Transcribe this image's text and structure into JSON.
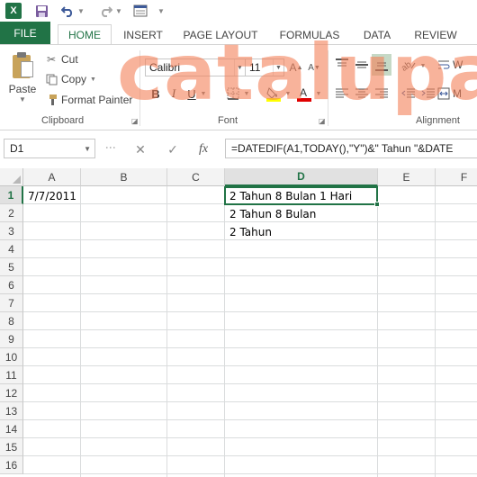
{
  "app": {
    "logo_text": "X"
  },
  "qat": {
    "save_icon": "save-icon",
    "undo_icon": "undo-icon",
    "redo_icon": "redo-icon",
    "customize_icon": "customize-icon"
  },
  "tabs": [
    {
      "label": "FILE"
    },
    {
      "label": "HOME"
    },
    {
      "label": "INSERT"
    },
    {
      "label": "PAGE LAYOUT"
    },
    {
      "label": "FORMULAS"
    },
    {
      "label": "DATA"
    },
    {
      "label": "REVIEW"
    }
  ],
  "ribbon": {
    "clipboard": {
      "paste_label": "Paste",
      "cut_label": "Cut",
      "copy_label": "Copy",
      "format_painter_label": "Format Painter",
      "group_label": "Clipboard"
    },
    "font": {
      "font_name": "Calibri",
      "font_size": "11",
      "group_label": "Font"
    },
    "alignment": {
      "group_label": "Alignment",
      "wrap_label": "W",
      "merge_label": "M"
    }
  },
  "watermark": "catalupa",
  "formula_bar": {
    "name_box": "D1",
    "fx_label": "fx",
    "formula": "=DATEDIF(A1,TODAY(),\"Y\")&\" Tahun \"&DATE"
  },
  "grid": {
    "columns": [
      "A",
      "B",
      "C",
      "D",
      "E",
      "F"
    ],
    "rows": [
      "1",
      "2",
      "3",
      "4",
      "5",
      "6",
      "7",
      "8",
      "9",
      "10",
      "11",
      "12",
      "13",
      "14",
      "15",
      "16"
    ],
    "selected_column": "D",
    "selected_row": "1",
    "cells": {
      "A1": "7/7/2011",
      "D1": "2 Tahun 8 Bulan 1 Hari",
      "D2": "2 Tahun 8 Bulan",
      "D3": "2 Tahun"
    }
  },
  "colors": {
    "accent": "#217346",
    "watermark": "#f38058"
  }
}
